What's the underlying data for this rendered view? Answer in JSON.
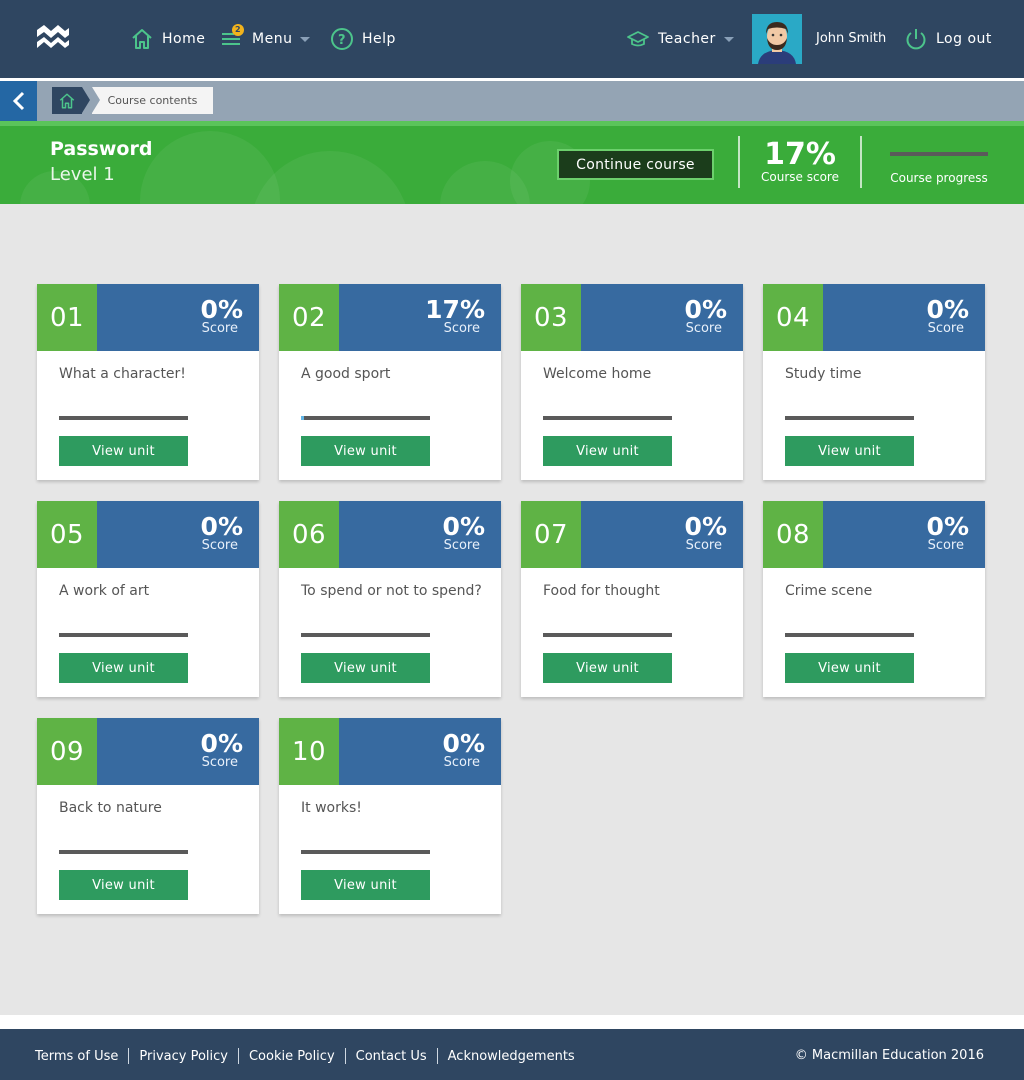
{
  "header": {
    "nav": {
      "home": "Home",
      "menu": "Menu",
      "menu_badge": "2",
      "help": "Help"
    },
    "role": "Teacher",
    "user_name": "John Smith",
    "logout": "Log out"
  },
  "breadcrumb": {
    "current": "Course contents"
  },
  "course": {
    "name": "Password",
    "level": "Level 1",
    "continue_label": "Continue course",
    "score": "17%",
    "score_caption": "Course score",
    "progress_caption": "Course progress",
    "progress": 0
  },
  "units": [
    {
      "num": "01",
      "score": "0%",
      "score_label": "Score",
      "title": "What a character!",
      "progress": 0,
      "button": "View unit"
    },
    {
      "num": "02",
      "score": "17%",
      "score_label": "Score",
      "title": "A good sport",
      "progress": 0.02,
      "button": "View unit"
    },
    {
      "num": "03",
      "score": "0%",
      "score_label": "Score",
      "title": "Welcome home",
      "progress": 0,
      "button": "View unit"
    },
    {
      "num": "04",
      "score": "0%",
      "score_label": "Score",
      "title": "Study time",
      "progress": 0,
      "button": "View unit"
    },
    {
      "num": "05",
      "score": "0%",
      "score_label": "Score",
      "title": "A work of art",
      "progress": 0,
      "button": "View unit"
    },
    {
      "num": "06",
      "score": "0%",
      "score_label": "Score",
      "title": "To spend or not to spend?",
      "progress": 0,
      "button": "View unit"
    },
    {
      "num": "07",
      "score": "0%",
      "score_label": "Score",
      "title": "Food for thought",
      "progress": 0,
      "button": "View unit"
    },
    {
      "num": "08",
      "score": "0%",
      "score_label": "Score",
      "title": "Crime scene",
      "progress": 0,
      "button": "View unit"
    },
    {
      "num": "09",
      "score": "0%",
      "score_label": "Score",
      "title": "Back to nature",
      "progress": 0,
      "button": "View unit"
    },
    {
      "num": "10",
      "score": "0%",
      "score_label": "Score",
      "title": "It works!",
      "progress": 0,
      "button": "View unit"
    }
  ],
  "footer": {
    "links": [
      "Terms of Use",
      "Privacy Policy",
      "Cookie Policy",
      "Contact Us",
      "Acknowledgements"
    ],
    "copyright": "© Macmillan Education 2016"
  },
  "colors": {
    "header_bg": "#2f4661",
    "course_band": "#3aac3a",
    "unit_number": "#5fb345",
    "unit_header": "#376aa0",
    "view_button": "#2e9b5f"
  },
  "icons": {
    "logo": "macmillan-logo",
    "home": "house-icon",
    "menu": "menu-lines-icon",
    "help": "question-circle-icon",
    "role": "graduation-cap-icon",
    "logout": "power-icon",
    "back": "chevron-left-icon"
  }
}
